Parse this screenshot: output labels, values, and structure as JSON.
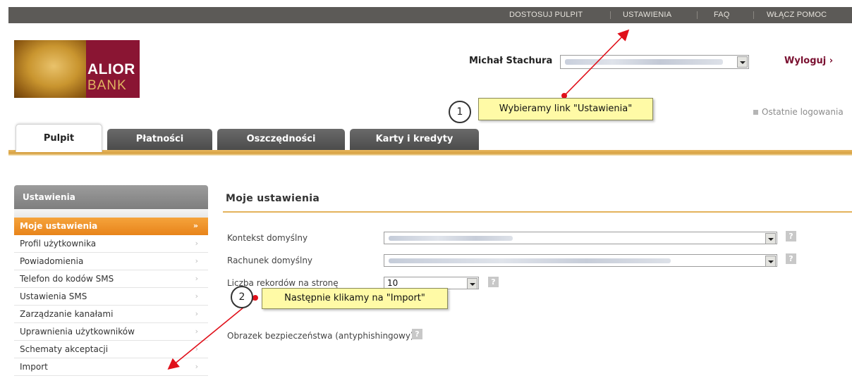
{
  "topnav": {
    "customize": "DOSTOSUJ PULPIT",
    "settings": "USTAWIENIA",
    "faq": "FAQ",
    "help": "WŁĄCZ POMOC"
  },
  "logo": {
    "line1": "ALIOR",
    "line2": "BANK"
  },
  "user": {
    "name": "Michał Stachura",
    "logout": "Wyloguj ›",
    "last_logins": "Ostatnie logowania"
  },
  "tabs": [
    "Pulpit",
    "Płatności",
    "Oszczędności",
    "Karty i kredyty"
  ],
  "sidebar": {
    "title": "Ustawienia",
    "items": [
      {
        "label": "Moje ustawienia",
        "arrow": "»"
      },
      {
        "label": "Profil użytkownika",
        "arrow": "›"
      },
      {
        "label": "Powiadomienia",
        "arrow": "›"
      },
      {
        "label": "Telefon do kodów SMS",
        "arrow": "›"
      },
      {
        "label": "Ustawienia SMS",
        "arrow": "›"
      },
      {
        "label": "Zarządzanie kanałami",
        "arrow": "›"
      },
      {
        "label": "Uprawnienia użytkowników",
        "arrow": "›"
      },
      {
        "label": "Schematy akceptacji",
        "arrow": "›"
      },
      {
        "label": "Import",
        "arrow": "›"
      }
    ]
  },
  "main": {
    "title": "Moje ustawienia",
    "fields": {
      "context_label": "Kontekst domyślny",
      "account_label": "Rachunek domyślny",
      "records_label": "Liczba rekordów na stronę",
      "records_value": "10",
      "security_image_label": "Obrazek bezpieczeństwa (antyphishingowy)"
    },
    "help_glyph": "?"
  },
  "callouts": {
    "step1_number": "1",
    "step1_text": "Wybieramy link \"Ustawienia\"",
    "step2_number": "2",
    "step2_text": "Następnie klikamy na \"Import\""
  },
  "colors": {
    "accent_orange": "#e8841a",
    "brand_burgundy": "#8a1533",
    "callout_yellow": "#fffaa6",
    "arrow_red": "#e0101a"
  },
  "icons": [
    "lock-icon",
    "help-icon",
    "dropdown-arrow-icon",
    "chevron-right-icon"
  ]
}
